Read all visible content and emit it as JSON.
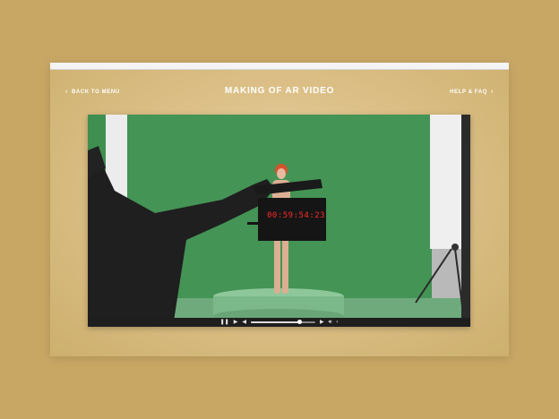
{
  "nav": {
    "back_label": "BACK TO MENU",
    "title": "MAKING OF AR VIDEO",
    "help_label": "HELP & FAQ"
  },
  "video": {
    "timecode": "00:59:54:23",
    "progress": 0.76
  },
  "icons": {
    "back": "chevron-left-icon",
    "help": "chevron-right-icon",
    "pause": "pause-icon",
    "play": "play-icon",
    "prev": "rewind-icon",
    "next": "forward-icon",
    "volume": "volume-icon",
    "share": "share-icon"
  },
  "colors": {
    "background": "#c8a765",
    "green_screen": "#3b8b4f",
    "timecode": "#ff2a2a"
  }
}
